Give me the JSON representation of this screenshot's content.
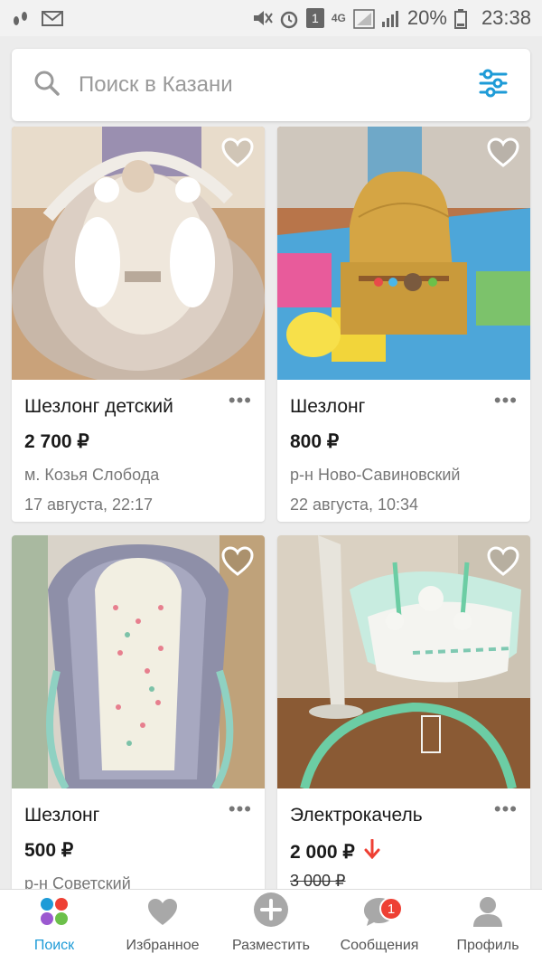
{
  "statusbar": {
    "battery_percent": "20%",
    "time": "23:38",
    "network": "4G",
    "sim": "1"
  },
  "search": {
    "placeholder": "Поиск в Казани",
    "accent_color": "#1e9bd7"
  },
  "listings": [
    {
      "title": "Шезлонг детский",
      "price": "2 700 ₽",
      "location": "м. Козья Слобода",
      "date": "17 августа, 22:17",
      "more": "•••",
      "photo_icon": "baby-bouncer-photo"
    },
    {
      "title": "Шезлонг",
      "price": "800 ₽",
      "location": "р-н Ново-Савиновский",
      "date": "22 августа, 10:34",
      "more": "•••",
      "photo_icon": "baby-bouncer-photo"
    },
    {
      "title": "Шезлонг",
      "price": "500 ₽",
      "location": "р-н Советский",
      "more": "•••",
      "photo_icon": "baby-bouncer-photo"
    },
    {
      "title": "Электрокачель",
      "price": "2 000 ₽",
      "old_price": "3 000 ₽",
      "more": "•••",
      "photo_icon": "baby-swing-photo",
      "price_drop_color": "#ee4034"
    }
  ],
  "tabbar": {
    "tabs": [
      {
        "label": "Поиск",
        "icon": "search-dots-icon",
        "active": true
      },
      {
        "label": "Избранное",
        "icon": "heart-icon"
      },
      {
        "label": "Разместить",
        "icon": "plus-circle-icon"
      },
      {
        "label": "Сообщения",
        "icon": "chat-bubble-icon",
        "badge": "1"
      },
      {
        "label": "Профиль",
        "icon": "person-icon"
      }
    ]
  }
}
